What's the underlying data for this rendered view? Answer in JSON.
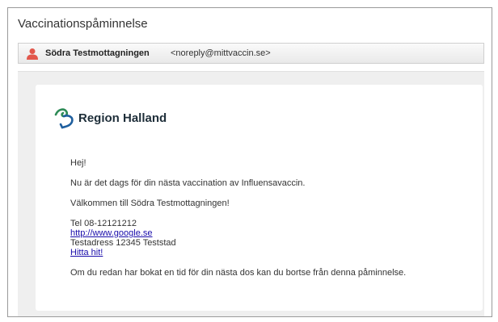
{
  "email": {
    "subject": "Vaccinationspåminnelse",
    "sender_name": "Södra Testmottagningen",
    "sender_email": "<noreply@mittvaccin.se>"
  },
  "logo": {
    "text": "Region Halland",
    "colors": [
      "#2e8b57",
      "#1f5f9e"
    ]
  },
  "body": {
    "greeting": "Hej!",
    "line1": "Nu är det dags för din nästa vaccination av Influensavaccin.",
    "line2": "Välkommen till Södra Testmottagningen!",
    "phone": "Tel 08-12121212",
    "website_link": "http://www.google.se",
    "address": "Testadress 12345 Teststad",
    "directions_link": "Hitta hit!",
    "closing": "Om du redan har bokat en tid för din nästa dos kan du bortse från denna påminnelse."
  },
  "colors": {
    "link": "#1a0dab",
    "avatar": "#e2574c"
  }
}
